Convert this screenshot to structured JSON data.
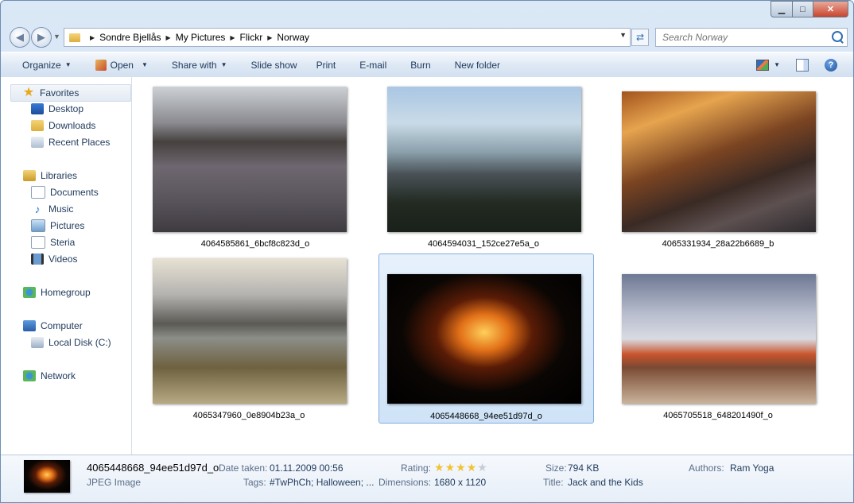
{
  "window": {
    "caption_min": "▁",
    "caption_max": "□",
    "caption_close": "✕"
  },
  "address": {
    "crumbs": [
      "Sondre Bjellås",
      "My Pictures",
      "Flickr",
      "Norway"
    ],
    "search_placeholder": "Search Norway"
  },
  "toolbar": {
    "organize": "Organize",
    "open": "Open",
    "share_with": "Share with",
    "slide_show": "Slide show",
    "print": "Print",
    "email": "E-mail",
    "burn": "Burn",
    "new_folder": "New folder"
  },
  "nav": {
    "favorites": "Favorites",
    "desktop": "Desktop",
    "downloads": "Downloads",
    "recent_places": "Recent Places",
    "libraries": "Libraries",
    "documents": "Documents",
    "music": "Music",
    "pictures": "Pictures",
    "steria": "Steria",
    "videos": "Videos",
    "homegroup": "Homegroup",
    "computer": "Computer",
    "local_disk": "Local Disk (C:)",
    "network": "Network"
  },
  "files": [
    {
      "name": "4064585861_6bcf8c823d_o"
    },
    {
      "name": "4064594031_152ce27e5a_o"
    },
    {
      "name": "4065331934_28a22b6689_b"
    },
    {
      "name": "4065347960_0e8904b23a_o"
    },
    {
      "name": "4065448668_94ee51d97d_o",
      "selected": true
    },
    {
      "name": "4065705518_648201490f_o"
    }
  ],
  "details": {
    "file_name": "4065448668_94ee51d97d_o",
    "file_type": "JPEG Image",
    "date_taken_label": "Date taken:",
    "date_taken": "01.11.2009 00:56",
    "tags_label": "Tags:",
    "tags": "#TwPhCh; Halloween; ...",
    "rating_label": "Rating:",
    "rating": 4,
    "rating_max": 5,
    "dimensions_label": "Dimensions:",
    "dimensions": "1680 x 1120",
    "size_label": "Size:",
    "size": "794 KB",
    "title_label": "Title:",
    "title": "Jack and the Kids",
    "authors_label": "Authors:",
    "authors": "Ram Yoga"
  }
}
